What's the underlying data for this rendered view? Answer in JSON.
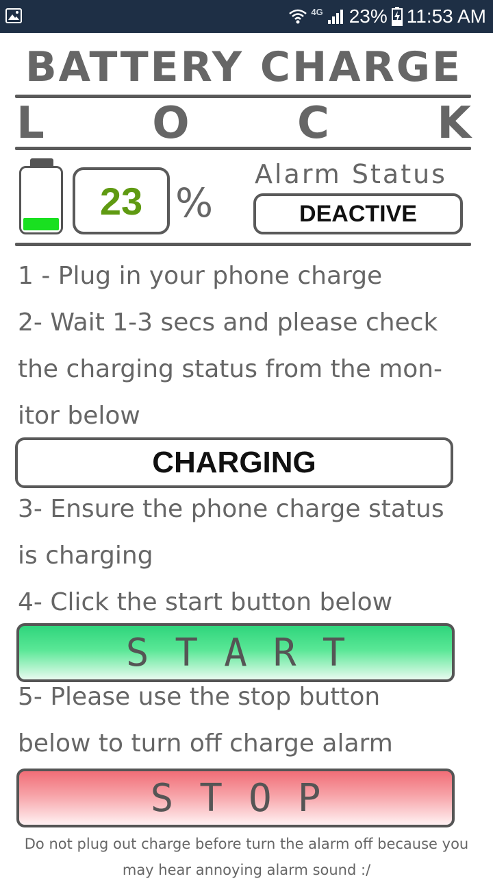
{
  "status_bar": {
    "network": "4G",
    "battery_percent": "23%",
    "time": "11:53 AM"
  },
  "header": {
    "title_line1": "BATTERY CHARGE",
    "title_line2_letters": [
      "L",
      "O",
      "C",
      "K"
    ]
  },
  "battery": {
    "level": "23",
    "percent_sign": "%",
    "fill_fraction": 0.23,
    "fill_color": "#19e020"
  },
  "alarm": {
    "label": "Alarm Status",
    "status": "DEACTIVE"
  },
  "steps": {
    "step1": "1 - Plug in your phone charge",
    "step2_line1": "2- Wait 1-3 secs and please check",
    "step2_line2": "the   charging status from the mon-",
    "step2_line3": "itor below",
    "step3_line1": "3- Ensure the phone charge status",
    "step3_line2": "is charging",
    "step4": "4- Click the start button below",
    "step5_line1": "5- Please use the stop button",
    "step5_line2": "below to turn off charge alarm"
  },
  "charging_status": "CHARGING",
  "buttons": {
    "start": "START",
    "stop": "STOP"
  },
  "footer": {
    "line1": "Do not plug out charge before turn the alarm off because you",
    "line2": "may hear annoying alarm sound :/"
  },
  "colors": {
    "status_bar_bg": "#1e2f45",
    "text_gray": "#666666",
    "percent_green": "#5f9a12",
    "start_green": "#2fd57c",
    "stop_red": "#f16e77"
  }
}
